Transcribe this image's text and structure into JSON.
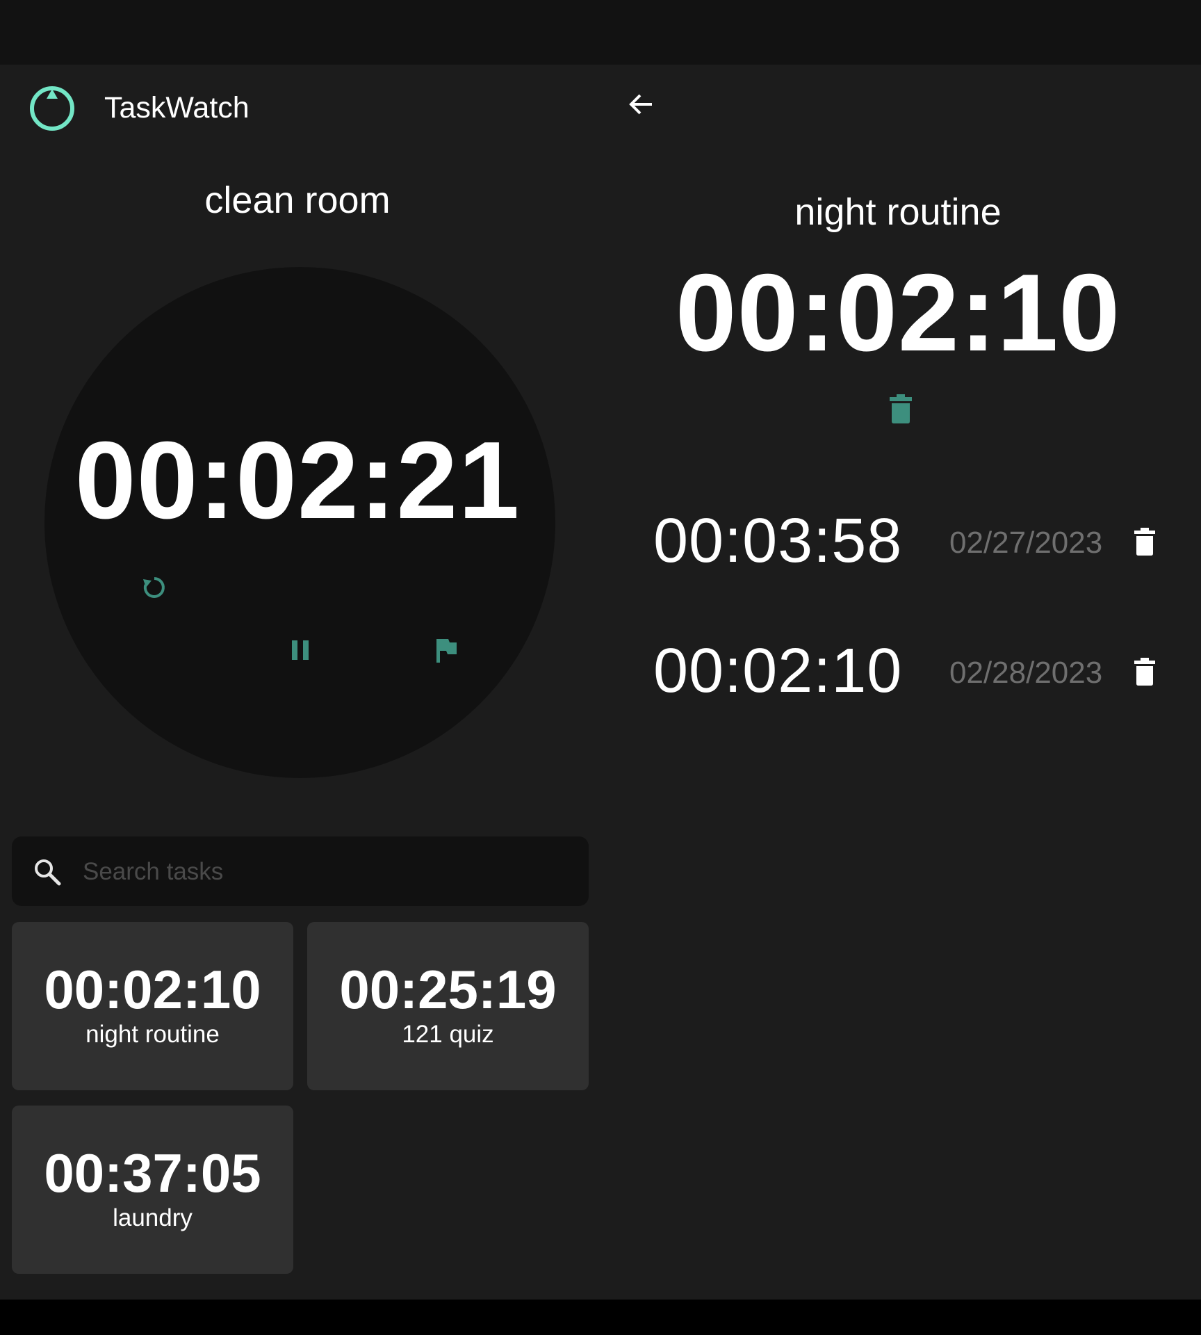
{
  "app": {
    "title": "TaskWatch",
    "accent_color": "#73e6c6",
    "control_color": "#3d8f7e"
  },
  "current_task": {
    "name": "clean room",
    "elapsed": "00:02:21",
    "controls": [
      "reset-icon",
      "pause-icon",
      "flag-icon"
    ]
  },
  "search": {
    "placeholder": "Search tasks",
    "value": ""
  },
  "tasks": [
    {
      "time": "00:02:10",
      "name": "night routine"
    },
    {
      "time": "00:25:19",
      "name": "121 quiz"
    },
    {
      "time": "00:37:05",
      "name": "laundry"
    }
  ],
  "detail": {
    "name": "night routine",
    "total": "00:02:10",
    "logs": [
      {
        "time": "00:03:58",
        "date": "02/27/2023"
      },
      {
        "time": "00:02:10",
        "date": "02/28/2023"
      }
    ]
  }
}
